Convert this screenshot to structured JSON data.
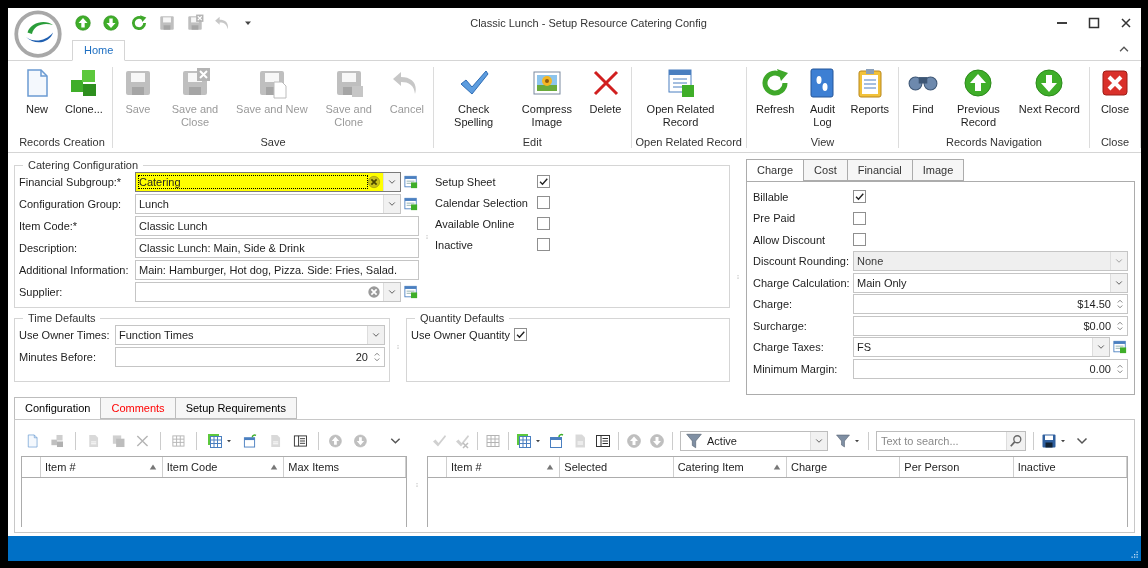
{
  "window": {
    "title": "Classic Lunch - Setup Resource Catering Config"
  },
  "ribbon_tabs": [
    {
      "label": "Home",
      "selected": true
    }
  ],
  "ribbon_groups": [
    {
      "label": "Records Creation",
      "buttons": [
        {
          "label": "New",
          "disabled": false
        },
        {
          "label": "Clone...",
          "disabled": false
        }
      ]
    },
    {
      "label": "Save",
      "buttons": [
        {
          "label": "Save",
          "disabled": true
        },
        {
          "label": "Save and Close",
          "disabled": true
        },
        {
          "label": "Save and New",
          "disabled": true
        },
        {
          "label": "Save and Clone",
          "disabled": true
        },
        {
          "label": "Cancel",
          "disabled": true
        }
      ]
    },
    {
      "label": "Edit",
      "buttons": [
        {
          "label": "Check Spelling",
          "disabled": false
        },
        {
          "label": "Compress Image",
          "disabled": false
        },
        {
          "label": "Delete",
          "disabled": false
        }
      ]
    },
    {
      "label": "Open Related Record",
      "buttons": [
        {
          "label": "Open Related Record",
          "disabled": false
        }
      ]
    },
    {
      "label": "View",
      "buttons": [
        {
          "label": "Refresh",
          "disabled": false
        },
        {
          "label": "Audit Log",
          "disabled": false
        },
        {
          "label": "Reports",
          "disabled": false
        }
      ]
    },
    {
      "label": "Records Navigation",
      "buttons": [
        {
          "label": "Find",
          "disabled": false
        },
        {
          "label": "Previous Record",
          "disabled": false
        },
        {
          "label": "Next Record",
          "disabled": false
        }
      ]
    },
    {
      "label": "Close",
      "buttons": [
        {
          "label": "Close",
          "disabled": false
        }
      ]
    }
  ],
  "catering_configuration": {
    "title": "Catering Configuration",
    "fields": [
      {
        "label": "Financial Subgroup:*",
        "kind": "combo",
        "value": "Catering",
        "focused": true,
        "clear": true,
        "lookup": true
      },
      {
        "label": "Configuration Group:",
        "kind": "combo",
        "value": "Lunch",
        "focused": false,
        "clear": false,
        "lookup": true
      },
      {
        "label": "Item Code:*",
        "kind": "text",
        "value": "Classic Lunch"
      },
      {
        "label": "Description:",
        "kind": "text",
        "value": "Classic Lunch: Main, Side & Drink"
      },
      {
        "label": "Additional Information:",
        "kind": "text",
        "value": "Main: Hamburger, Hot dog, Pizza. Side: Fries, Salad."
      },
      {
        "label": "Supplier:",
        "kind": "combo",
        "focused": false,
        "clear": true,
        "lookup": true
      }
    ],
    "checks": [
      {
        "label": "Setup Sheet",
        "checked": true
      },
      {
        "label": "Calendar Selection",
        "checked": false
      },
      {
        "label": "Available Online",
        "checked": false
      },
      {
        "label": "Inactive",
        "checked": false
      }
    ]
  },
  "time_defaults": {
    "title": "Time Defaults",
    "fields": [
      {
        "label": "Use Owner Times:",
        "kind": "combo",
        "value": "Function Times"
      },
      {
        "label": "Minutes Before:",
        "kind": "spin",
        "value": "20"
      }
    ]
  },
  "quantity_defaults": {
    "title": "Quantity Defaults",
    "checks": [
      {
        "label": "Use Owner Quantity",
        "checked": true
      }
    ]
  },
  "detail_tabs": [
    {
      "label": "Charge",
      "selected": true
    },
    {
      "label": "Cost",
      "selected": false
    },
    {
      "label": "Financial",
      "selected": false
    },
    {
      "label": "Image",
      "selected": false
    }
  ],
  "charge_fields": [
    {
      "label": "Billable",
      "kind": "check",
      "checked": true
    },
    {
      "label": "Pre Paid",
      "kind": "check",
      "checked": false
    },
    {
      "label": "Allow Discount",
      "kind": "check",
      "checked": false
    },
    {
      "label": "Discount Rounding:",
      "kind": "combo",
      "value": "None",
      "disabled": true,
      "lookup": false
    },
    {
      "label": "Charge Calculation:",
      "kind": "combo",
      "value": "Main Only",
      "disabled": false,
      "lookup": false
    },
    {
      "label": "Charge:",
      "kind": "spin",
      "value": "$14.50"
    },
    {
      "label": "Surcharge:",
      "kind": "spin",
      "value": "$0.00"
    },
    {
      "label": "Charge Taxes:",
      "kind": "combo",
      "value": "FS",
      "disabled": false,
      "lookup": true
    },
    {
      "label": "Minimum Margin:",
      "kind": "spin",
      "value": "0.00"
    }
  ],
  "bottom_tabs": [
    {
      "label": "Configuration",
      "selected": true,
      "color": "#000000"
    },
    {
      "label": "Comments",
      "selected": false,
      "color": "#ff0000"
    },
    {
      "label": "Setup Requirements",
      "selected": false,
      "color": "#000000"
    }
  ],
  "left_grid": {
    "columns": [
      {
        "label": "Item #",
        "sorted": true
      },
      {
        "label": "Item Code",
        "sorted": true
      },
      {
        "label": "Max Items",
        "sorted": false
      }
    ]
  },
  "right_toolbar": {
    "filter": "Active",
    "search": {
      "placeholder": "Text to search..."
    }
  },
  "right_grid": {
    "columns": [
      {
        "label": "Item #",
        "sorted": true
      },
      {
        "label": "Selected",
        "sorted": false
      },
      {
        "label": "Catering Item",
        "sorted": true
      },
      {
        "label": "Charge",
        "sorted": false
      },
      {
        "label": "Per Person",
        "sorted": false
      },
      {
        "label": "Inactive",
        "sorted": false
      }
    ]
  }
}
